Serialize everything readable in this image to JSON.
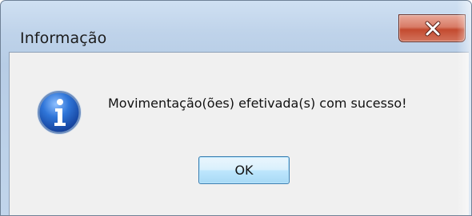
{
  "window": {
    "title": "Informação"
  },
  "titlebar": {
    "close_icon": "close-x-icon"
  },
  "dialog": {
    "icon": "info-icon",
    "message": "Movimentação(ões) efetivada(s) com sucesso!",
    "ok_label": "OK"
  },
  "colors": {
    "title_bar": "#bfd3ea",
    "close_button": "#c34a2f",
    "client_area": "#f0f0f0",
    "info_icon": "#1f5fc4",
    "ok_button": "#bee6fd"
  }
}
